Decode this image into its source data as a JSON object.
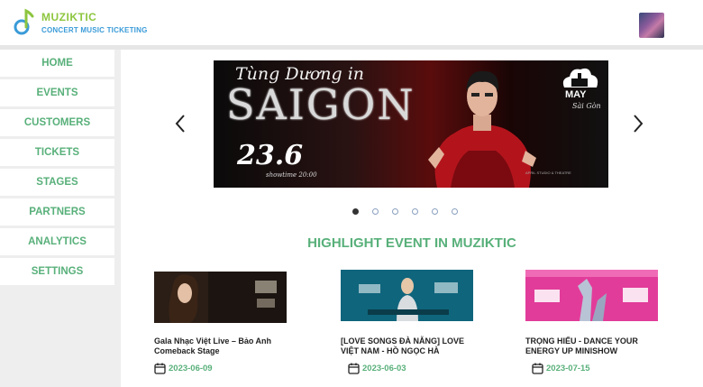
{
  "header": {
    "brand": "MUZIKTIC",
    "tagline": "CONCERT MUSIC TICKETING",
    "logo_icon": "music-note-icon",
    "avatar_icon": "user-avatar"
  },
  "sidebar": {
    "items": [
      {
        "label": "HOME"
      },
      {
        "label": "EVENTS"
      },
      {
        "label": "CUSTOMERS"
      },
      {
        "label": "TICKETS"
      },
      {
        "label": "STAGES"
      },
      {
        "label": "PARTNERS"
      },
      {
        "label": "ANALYTICS"
      },
      {
        "label": "SETTINGS"
      }
    ]
  },
  "carousel": {
    "banner": {
      "script_title": "Tùng Dương in",
      "city": "SAIGON",
      "date": "23.6",
      "showtime": "showtime 20:00",
      "venue": "MAY",
      "venue_sub": "Sài Gòn",
      "fine_print": "APRIL STUDIO & THEATRE"
    },
    "prev_icon": "chevron-left-icon",
    "next_icon": "chevron-right-icon",
    "slide_count": 6,
    "active_index": 0
  },
  "highlight": {
    "title": "HIGHLIGHT EVENT IN MUZIKTIC",
    "events": [
      {
        "title": "Gala Nhạc Việt Live – Bảo Anh Comeback Stage",
        "date": "2023-06-09"
      },
      {
        "title": "[LOVE SONGS ĐÀ NẴNG] LOVE VIỆT NAM - HỒ NGỌC HÀ",
        "date": "2023-06-03"
      },
      {
        "title": "TRỌNG HIẾU - DANCE YOUR ENERGY UP MINISHOW",
        "date": "2023-07-15"
      }
    ]
  },
  "colors": {
    "accent_green": "#58b07a",
    "brand_green": "#8dc63f",
    "brand_blue": "#3a9bd8"
  }
}
